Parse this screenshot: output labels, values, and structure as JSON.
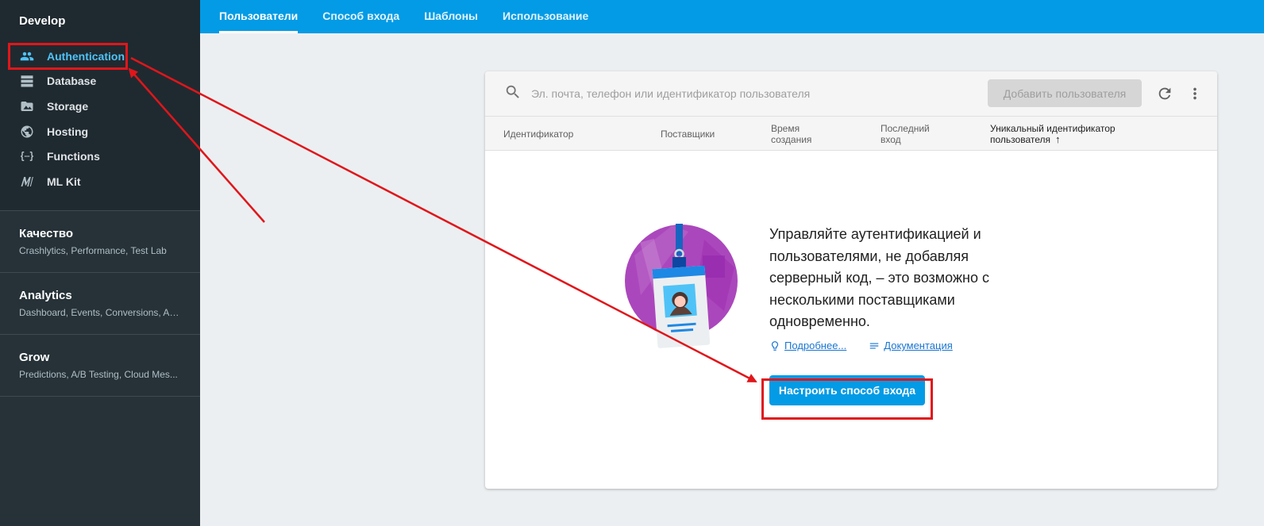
{
  "sidebar": {
    "section_title": "Develop",
    "items": [
      {
        "label": "Authentication",
        "icon": "people-icon",
        "active": true
      },
      {
        "label": "Database",
        "icon": "database-icon"
      },
      {
        "label": "Storage",
        "icon": "folder-image-icon"
      },
      {
        "label": "Hosting",
        "icon": "globe-icon"
      },
      {
        "label": "Functions",
        "icon": "functions-icon"
      },
      {
        "label": "ML Kit",
        "icon": "ml-kit-icon"
      }
    ],
    "groups": [
      {
        "title": "Качество",
        "subtitle": "Crashlytics, Performance, Test Lab"
      },
      {
        "title": "Analytics",
        "subtitle": "Dashboard, Events, Conversions, Au..."
      },
      {
        "title": "Grow",
        "subtitle": "Predictions, A/B Testing, Cloud Mes..."
      }
    ]
  },
  "tabs": [
    {
      "label": "Пользователи",
      "active": true
    },
    {
      "label": "Способ входа"
    },
    {
      "label": "Шаблоны"
    },
    {
      "label": "Использование"
    }
  ],
  "users_table": {
    "search_placeholder": "Эл. почта, телефон или идентификатор пользователя",
    "add_user_label": "Добавить пользователя",
    "columns": [
      {
        "label": "Идентификатор"
      },
      {
        "label": "Поставщики"
      },
      {
        "label": "Время создания"
      },
      {
        "label": "Последний вход"
      },
      {
        "label": "Уникальный идентификатор пользователя",
        "sorted": "asc",
        "sort_glyph": "↑"
      }
    ]
  },
  "empty_state": {
    "message": "Управляйте аутентификацией и пользователями, не добавляя серверный код, – это возможно с несколькими поставщиками одновременно.",
    "learn_more": "Подробнее...",
    "docs": "Документация",
    "setup_button": "Настроить способ входа"
  },
  "colors": {
    "sidebar_bg": "#263238",
    "topbar_bg": "#039be5",
    "active_nav": "#4fc3f7",
    "annotation_red": "#e0161b",
    "primary_button": "#039be5"
  }
}
